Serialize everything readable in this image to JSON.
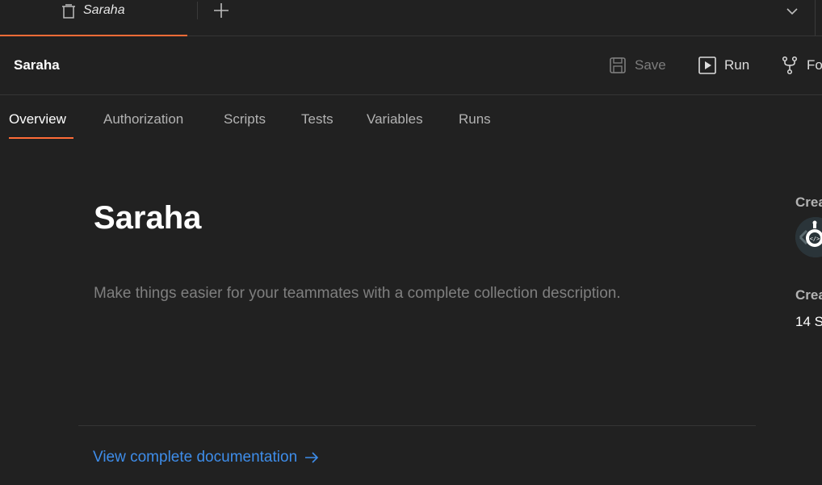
{
  "tab": {
    "title": "Saraha"
  },
  "header": {
    "collection_name": "Saraha",
    "save_label": "Save",
    "run_label": "Run",
    "fork_label": "Fo"
  },
  "subtabs": [
    {
      "label": "Overview"
    },
    {
      "label": "Authorization"
    },
    {
      "label": "Scripts"
    },
    {
      "label": "Tests"
    },
    {
      "label": "Variables"
    },
    {
      "label": "Runs"
    }
  ],
  "main": {
    "title": "Saraha",
    "description_placeholder": "Make things easier for your teammates with a complete collection description.",
    "doc_link": "View complete documentation"
  },
  "side": {
    "created_by_label": "Crea",
    "created_on_label": "Crea",
    "created_on_value": "14 S"
  },
  "colors": {
    "accent": "#ff6c37",
    "link": "#3e8dea",
    "background": "#212121"
  },
  "icons": {
    "tab": "collection-icon",
    "add": "plus-icon",
    "menu": "chevron-down-icon",
    "save": "save-icon",
    "run": "play-icon",
    "fork": "fork-icon",
    "link": "arrow-right-icon"
  }
}
